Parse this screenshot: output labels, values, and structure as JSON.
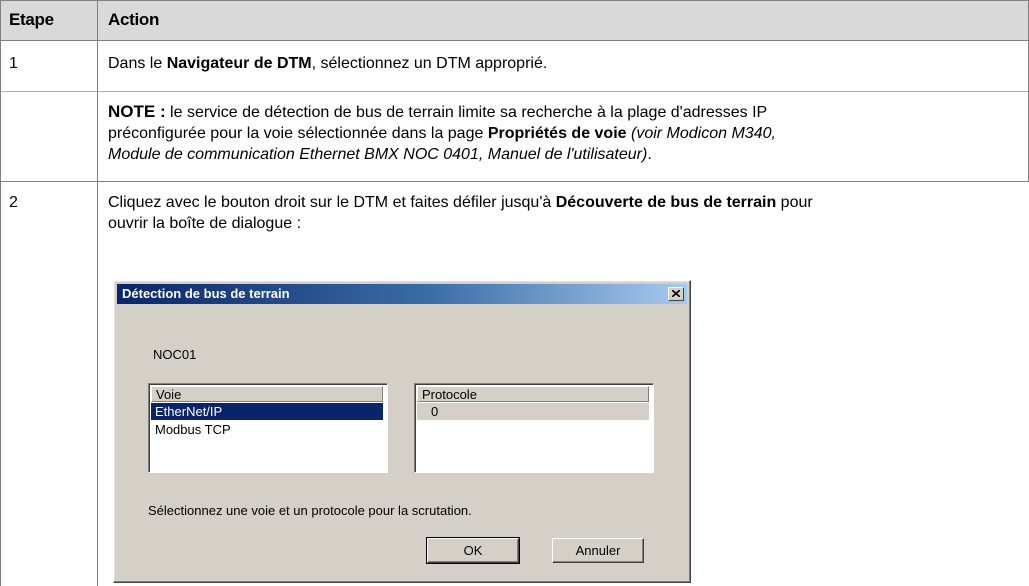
{
  "table": {
    "headers": {
      "step": "Etape",
      "action": "Action"
    },
    "rows": [
      {
        "step": "1",
        "line1": {
          "before": "Dans le ",
          "bold": "Navigateur de DTM",
          "after": ", sélectionnez un DTM approprié."
        },
        "note": {
          "label": "NOTE :",
          "text1": " le service de détection de bus de terrain limite sa recherche à la plage d'adresses IP",
          "text2": "préconfigurée pour la voie sélectionnée dans la page ",
          "bold": "Propriétés de voie",
          "italic1": " (voir Modicon M340,",
          "italic2": "Module de communication Ethernet BMX NOC 0401, Manuel de l'utilisateur)",
          "end": "."
        }
      },
      {
        "step": "2",
        "line1": {
          "before": "Cliquez avec le bouton droit sur le DTM et faites défiler jusqu'à ",
          "bold": "Découverte de bus de terrain",
          "after": " pour"
        },
        "line2": "ouvrir la boîte de dialogue :"
      }
    ]
  },
  "dialog": {
    "title": "Détection de bus de terrain",
    "device": "NOC01",
    "channel_list": {
      "header": "Voie",
      "items": [
        "EtherNet/IP",
        "Modbus TCP"
      ],
      "selected": "EtherNet/IP"
    },
    "protocol_list": {
      "header": "Protocole",
      "items": [
        "0"
      ]
    },
    "hint": "Sélectionnez une voie et un protocole pour la scrutation.",
    "ok_label": "OK",
    "cancel_label": "Annuler",
    "close_icon": "close-icon",
    "colors": {
      "title_start": "#0a246a",
      "title_end": "#a6caf0",
      "face": "#d4d0c8",
      "selection": "#0a246a"
    }
  }
}
